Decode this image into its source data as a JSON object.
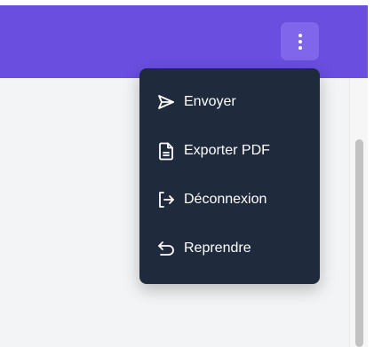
{
  "header": {
    "more_icon": "more-vertical-icon",
    "accent_color": "#6a4ee0"
  },
  "menu": {
    "background": "#1f2a3d",
    "items": [
      {
        "label": "Envoyer",
        "icon": "send-icon"
      },
      {
        "label": "Exporter PDF",
        "icon": "file-text-icon"
      },
      {
        "label": "Déconnexion",
        "icon": "logout-icon"
      },
      {
        "label": "Reprendre",
        "icon": "undo-icon"
      }
    ]
  }
}
